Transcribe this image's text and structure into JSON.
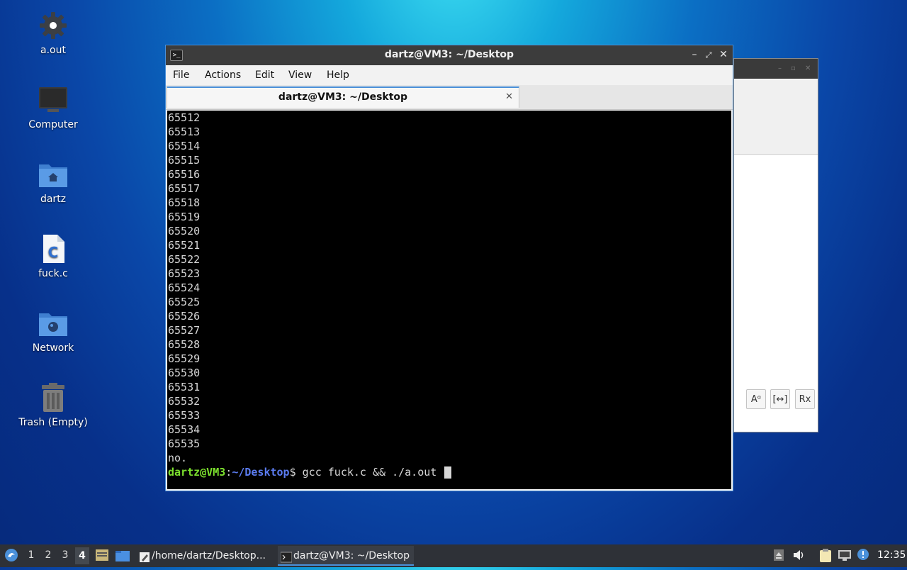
{
  "desktop": {
    "icons": [
      {
        "label": "a.out"
      },
      {
        "label": "Computer"
      },
      {
        "label": "dartz"
      },
      {
        "label": "fuck.c"
      },
      {
        "label": "Network"
      },
      {
        "label": "Trash (Empty)"
      }
    ]
  },
  "terminal": {
    "title": "dartz@VM3: ~/Desktop",
    "menu": [
      "File",
      "Actions",
      "Edit",
      "View",
      "Help"
    ],
    "tab_label": "dartz@VM3: ~/Desktop",
    "output_lines": [
      "65512",
      "65513",
      "65514",
      "65515",
      "65516",
      "65517",
      "65518",
      "65519",
      "65520",
      "65521",
      "65522",
      "65523",
      "65524",
      "65525",
      "65526",
      "65527",
      "65528",
      "65529",
      "65530",
      "65531",
      "65532",
      "65533",
      "65534",
      "65535",
      "no."
    ],
    "prompt_user": "dartz@VM3",
    "prompt_sep": ":",
    "prompt_path": "~/Desktop",
    "prompt_sym": "$ ",
    "command": "gcc fuck.c && ./a.out"
  },
  "bg_window": {
    "format_buttons": [
      "Aᵅ",
      "[↔]",
      "Rx"
    ]
  },
  "taskbar": {
    "workspaces": [
      "1",
      "2",
      "3",
      "4"
    ],
    "active_workspace": "4",
    "tasks": [
      {
        "label": "/home/dartz/Desktop..."
      },
      {
        "label": "dartz@VM3: ~/Desktop"
      }
    ],
    "clock": "12:35"
  },
  "colors": {
    "prompt_user": "#7ce02e",
    "prompt_path": "#5b7cf0",
    "accent": "#4a90d9"
  }
}
